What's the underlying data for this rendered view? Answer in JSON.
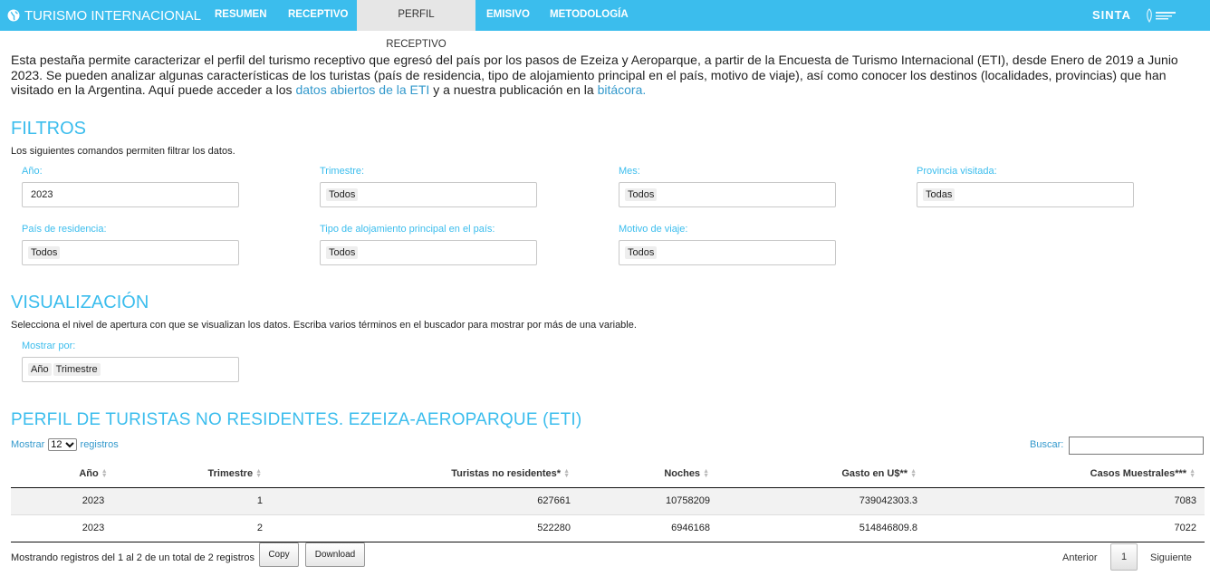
{
  "navbar": {
    "brand": "TURISMO INTERNACIONAL",
    "tabs": [
      "RESUMEN",
      "RECEPTIVO",
      "PERFIL RECEPTIVO",
      "EMISIVO",
      "METODOLOGÍA"
    ],
    "active_tab": "PERFIL RECEPTIVO",
    "sinta": "SINTA",
    "bg_color": "#3bbded"
  },
  "intro": {
    "text_before": "Esta pestaña permite caracterizar el perfil del turismo receptivo que egresó del país por los pasos de Ezeiza y Aeroparque, a partir de la Encuesta de Turismo Internacional (ETI), desde Enero de 2019 a Junio 2023. Se pueden analizar algunas características de los turistas (país de residencia, tipo de alojamiento principal en el país, motivo de viaje), así como conocer los destinos (localidades, provincias) que han visitado en la Argentina. Aquí puede acceder a los ",
    "link1": "datos abiertos de la ETI",
    "text_middle": " y a nuestra publicación en la ",
    "link2": "bitácora."
  },
  "filtros": {
    "title": "FILTROS",
    "subtitle": "Los siguientes comandos permiten filtrar los datos.",
    "fields": [
      {
        "label": "Año:",
        "value": "2023"
      },
      {
        "label": "Trimestre:",
        "value": "Todos"
      },
      {
        "label": "Mes:",
        "value": "Todos"
      },
      {
        "label": "Provincia visitada:",
        "value": "Todas"
      },
      {
        "label": "País de residencia:",
        "value": "Todos"
      },
      {
        "label": "Tipo de alojamiento principal en el país:",
        "value": "Todos"
      },
      {
        "label": "Motivo de viaje:",
        "value": "Todos"
      }
    ]
  },
  "visualizacion": {
    "title": "VISUALIZACIÓN",
    "subtitle": "Selecciona el nivel de apertura con que se visualizan los datos. Escriba varios términos en el buscador para mostrar por más de una variable.",
    "label": "Mostrar por:",
    "chips": [
      "Año",
      "Trimestre"
    ]
  },
  "table": {
    "title": "PERFIL DE TURISTAS NO RESIDENTES. EZEIZA-AEROPARQUE (ETI)",
    "show_label": "Mostrar",
    "page_length": "12",
    "records_label": "registros",
    "search_label": "Buscar:",
    "search_value": "",
    "columns": [
      "Año",
      "Trimestre",
      "Turistas no residentes*",
      "Noches",
      "Gasto en U$**",
      "Casos Muestrales***"
    ],
    "rows": [
      [
        "2023",
        "1",
        "627661",
        "10758209",
        "739042303.3",
        "7083"
      ],
      [
        "2023",
        "2",
        "522280",
        "6946168",
        "514846809.8",
        "7022"
      ]
    ],
    "info": "Mostrando registros del 1 al 2 de un total de 2 registros",
    "copy": "Copy",
    "download": "Download",
    "prev": "Anterior",
    "page": "1",
    "next": "Siguiente"
  }
}
